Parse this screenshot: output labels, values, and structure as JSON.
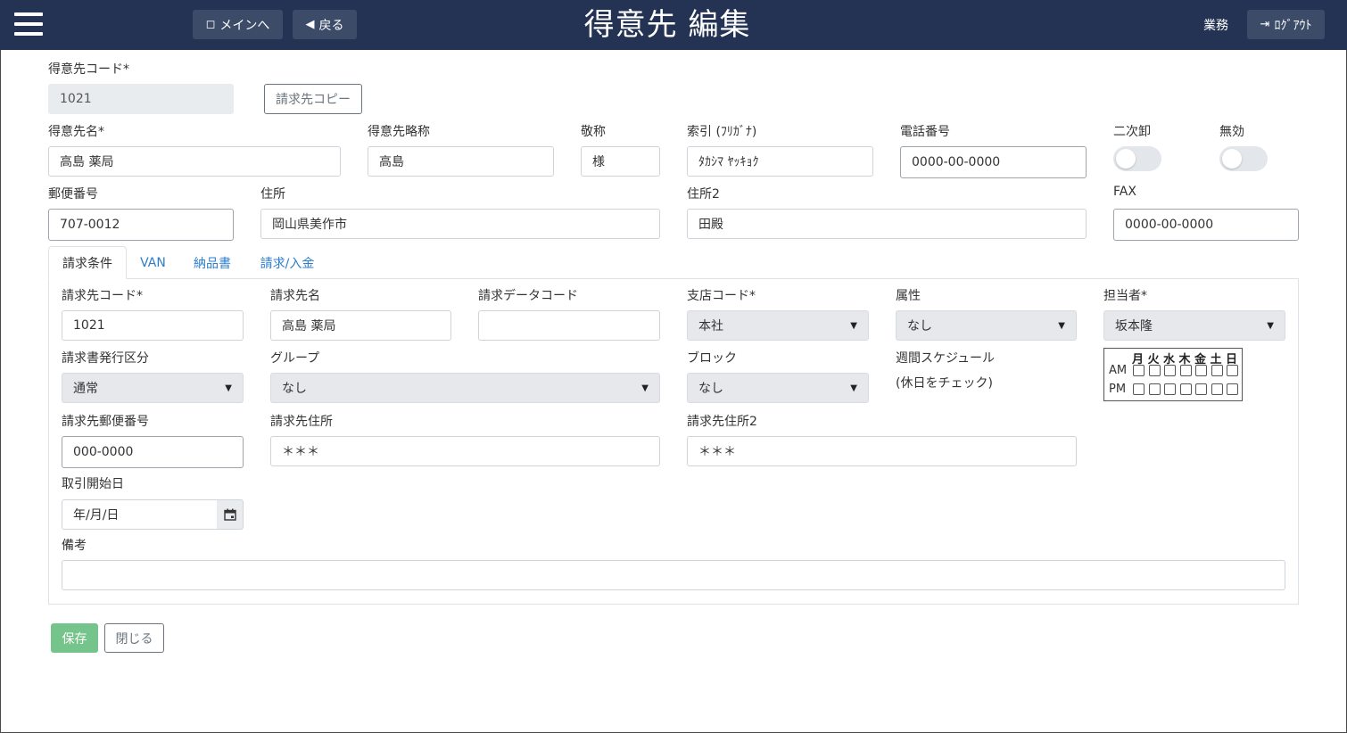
{
  "header": {
    "title": "得意先 編集",
    "main_menu_label": "メインへ",
    "back_label": "戻る",
    "dept_label": "業務",
    "logout_label": "ﾛｸﾞｱｳﾄ"
  },
  "customer": {
    "code_label": "得意先コード*",
    "code_value": "1021",
    "copy_billing_label": "請求先コピー",
    "name_label": "得意先名*",
    "name_value": "高島 薬局",
    "short_name_label": "得意先略称",
    "short_name_value": "高島",
    "honorific_label": "敬称",
    "honorific_value": "様",
    "index_label": "索引 (ﾌﾘｶﾞﾅ)",
    "index_value": "ﾀｶｼﾏ ﾔｯｷｮｸ",
    "phone_label": "電話番号",
    "phone_value": "0000-00-0000",
    "secondary_label": "二次卸",
    "secondary_on": false,
    "invalid_label": "無効",
    "invalid_on": false,
    "zip_label": "郵便番号",
    "zip_value": "707-0012",
    "address_label": "住所",
    "address_value": "岡山県美作市",
    "address2_label": "住所2",
    "address2_value": "田殿",
    "fax_label": "FAX",
    "fax_value": "0000-00-0000"
  },
  "tabs": [
    "請求条件",
    "VAN",
    "納品書",
    "請求/入金"
  ],
  "billing": {
    "code_label": "請求先コード*",
    "code_value": "1021",
    "name_label": "請求先名",
    "name_value": "高島 薬局",
    "data_code_label": "請求データコード",
    "data_code_value": "",
    "branch_label": "支店コード*",
    "branch_value": "本社",
    "attribute_label": "属性",
    "attribute_value": "なし",
    "staff_label": "担当者*",
    "staff_value": "坂本隆",
    "issue_type_label": "請求書発行区分",
    "issue_type_value": "通常",
    "group_label": "グループ",
    "group_value": "なし",
    "block_label": "ブロック",
    "block_value": "なし",
    "schedule_label": "週間スケジュール",
    "schedule_hint": "(休日をチェック)",
    "schedule_days": [
      "月",
      "火",
      "水",
      "木",
      "金",
      "土",
      "日"
    ],
    "schedule_am": "AM",
    "schedule_pm": "PM",
    "zip_label": "請求先郵便番号",
    "zip_value": "000-0000",
    "address_label": "請求先住所",
    "address_value": "＊＊＊",
    "address2_label": "請求先住所2",
    "address2_value": "＊＊＊",
    "start_date_label": "取引開始日",
    "start_date_placeholder": "年/月/日",
    "remarks_label": "備考",
    "remarks_value": ""
  },
  "actions": {
    "save_label": "保存",
    "close_label": "閉じる"
  },
  "colors": {
    "navbar": "#243353",
    "nav_button": "#3c4b68",
    "save": "#75c48b",
    "tab_link": "#2d7dcc"
  }
}
